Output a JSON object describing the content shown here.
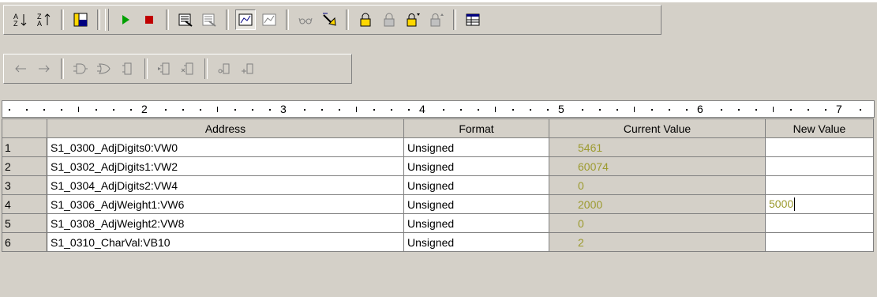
{
  "colors": {
    "bg": "#d4d0c8",
    "value_text": "#9c9a2e",
    "grid_line": "#808080"
  },
  "toolbar1": {
    "buttons": [
      "sort-ascending-icon",
      "sort-descending-icon",
      "view-icon",
      "run-icon",
      "stop-icon",
      "read-icon",
      "write-icon",
      "chart-status-icon",
      "chart-status-alt-icon",
      "glasses-icon",
      "force-icon",
      "lock-icon",
      "unlock-icon",
      "force-lock-icon",
      "unforce-icon",
      "table-icon"
    ]
  },
  "toolbar2": {
    "buttons": [
      "back-arrow-icon",
      "forward-arrow-icon",
      "and-gate-icon",
      "or-gate-icon",
      "box-icon",
      "insert-box-icon",
      "delete-box-icon",
      "contact-icon",
      "coil-icon"
    ]
  },
  "ruler": {
    "labels": [
      "2",
      "3",
      "4",
      "5",
      "6",
      "7"
    ]
  },
  "table": {
    "headers": {
      "address": "Address",
      "format": "Format",
      "current_value": "Current Value",
      "new_value": "New Value"
    },
    "rows": [
      {
        "num": "1",
        "address": "S1_0300_AdjDigits0:VW0",
        "format": "Unsigned",
        "current": "5461",
        "new": ""
      },
      {
        "num": "2",
        "address": "S1_0302_AdjDigits1:VW2",
        "format": "Unsigned",
        "current": "60074",
        "new": ""
      },
      {
        "num": "3",
        "address": "S1_0304_AdjDigits2:VW4",
        "format": "Unsigned",
        "current": "0",
        "new": ""
      },
      {
        "num": "4",
        "address": "S1_0306_AdjWeight1:VW6",
        "format": "Unsigned",
        "current": "2000",
        "new": "5000"
      },
      {
        "num": "5",
        "address": "S1_0308_AdjWeight2:VW8",
        "format": "Unsigned",
        "current": "0",
        "new": ""
      },
      {
        "num": "6",
        "address": "S1_0310_CharVal:VB10",
        "format": "Unsigned",
        "current": "2",
        "new": ""
      }
    ]
  }
}
